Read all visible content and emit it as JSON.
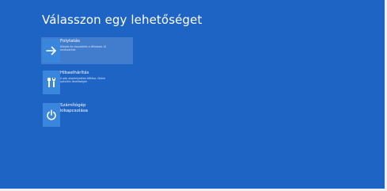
{
  "screen": {
    "title": "Válasszon egy lehetőséget",
    "background": "#1e64c4",
    "tile_color": "#3a86dc"
  },
  "options": [
    {
      "label": "Folytatás",
      "description": "Kilépés és visszatérés a Windows 10 rendszerhez",
      "icon": "arrow-right-icon",
      "selected": true
    },
    {
      "label": "Hibaelhárítás",
      "description": "A gép alaphelyzetbe állítása, illetve speciális lehetőségek",
      "icon": "tools-icon",
      "selected": false
    },
    {
      "label": "Számítógép kikapcsolása",
      "description": "",
      "icon": "power-icon",
      "selected": false
    }
  ]
}
